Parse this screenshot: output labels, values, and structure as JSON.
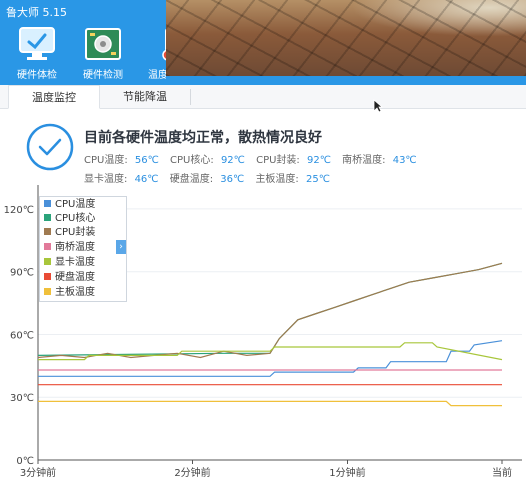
{
  "app": {
    "title": "鲁大师 5.15"
  },
  "nav": [
    {
      "label": "硬件体检",
      "icon": "monitor-check-icon"
    },
    {
      "label": "硬件检测",
      "icon": "circuit-board-icon"
    },
    {
      "label": "温度管理",
      "icon": "thermometer-icon"
    }
  ],
  "tabs": [
    {
      "label": "温度监控",
      "active": true
    },
    {
      "label": "节能降温",
      "active": false
    }
  ],
  "status": {
    "message": "目前各硬件温度均正常，散热情况良好",
    "icon": "check-circle-icon",
    "temps_row1": [
      {
        "label": "CPU温度:",
        "value": "56℃"
      },
      {
        "label": "CPU核心:",
        "value": "92℃"
      },
      {
        "label": "CPU封装:",
        "value": "92℃"
      },
      {
        "label": "南桥温度:",
        "value": "43℃"
      }
    ],
    "temps_row2": [
      {
        "label": "显卡温度:",
        "value": "46℃"
      },
      {
        "label": "硬盘温度:",
        "value": "36℃"
      },
      {
        "label": "主板温度:",
        "value": "25℃"
      }
    ]
  },
  "chart_data": {
    "type": "line",
    "ylim": [
      0,
      130
    ],
    "yticks": [
      "0℃",
      "30℃",
      "60℃",
      "90℃",
      "120℃"
    ],
    "ytick_values": [
      0,
      30,
      60,
      90,
      120
    ],
    "xlim": [
      0,
      1
    ],
    "xticks": [
      "3分钟前",
      "2分钟前",
      "1分钟前",
      "当前"
    ],
    "xtick_values": [
      0,
      0.333,
      0.667,
      1
    ],
    "grid": true,
    "legend_position": "top-left",
    "series": [
      {
        "name": "CPU温度",
        "color": "#4a90d9",
        "x": [
          0,
          0.5,
          0.51,
          0.68,
          0.69,
          0.75,
          0.76,
          0.88,
          0.89,
          0.93,
          0.94,
          1
        ],
        "y": [
          40,
          40,
          42,
          42,
          44,
          44,
          47,
          47,
          52,
          52,
          55,
          57
        ]
      },
      {
        "name": "CPU核心",
        "color": "#2aa37a",
        "x": [
          0,
          0.4,
          0.5,
          0.52,
          0.56,
          0.6,
          0.64,
          0.68,
          0.72,
          0.76,
          0.8,
          0.85,
          0.9,
          0.95,
          1
        ],
        "y": [
          50,
          51,
          51,
          58,
          67,
          70,
          73,
          76,
          79,
          82,
          85,
          87,
          89,
          91,
          94
        ]
      },
      {
        "name": "CPU封装",
        "color": "#a07a50",
        "x": [
          0,
          0.05,
          0.1,
          0.15,
          0.2,
          0.25,
          0.3,
          0.35,
          0.4,
          0.45,
          0.5,
          0.52,
          0.56,
          0.6,
          0.64,
          0.68,
          0.72,
          0.76,
          0.8,
          0.85,
          0.9,
          0.95,
          1
        ],
        "y": [
          49,
          50,
          49,
          51,
          49,
          50,
          51,
          49,
          52,
          50,
          51,
          58,
          67,
          70,
          73,
          76,
          79,
          82,
          85,
          87,
          89,
          91,
          94
        ]
      },
      {
        "name": "南桥温度",
        "color": "#e27a9a",
        "x": [
          0,
          1
        ],
        "y": [
          43,
          43
        ]
      },
      {
        "name": "显卡温度",
        "color": "#a8c63b",
        "x": [
          0,
          0.1,
          0.11,
          0.3,
          0.31,
          0.5,
          0.51,
          0.78,
          0.79,
          0.85,
          0.86,
          1
        ],
        "y": [
          48,
          48,
          50,
          50,
          52,
          52,
          54,
          54,
          56,
          56,
          54,
          48
        ]
      },
      {
        "name": "硬盘温度",
        "color": "#e94b35",
        "x": [
          0,
          1
        ],
        "y": [
          36,
          36
        ]
      },
      {
        "name": "主板温度",
        "color": "#f0c03b",
        "x": [
          0,
          0.88,
          0.89,
          1
        ],
        "y": [
          28,
          28,
          26,
          26
        ]
      }
    ]
  }
}
